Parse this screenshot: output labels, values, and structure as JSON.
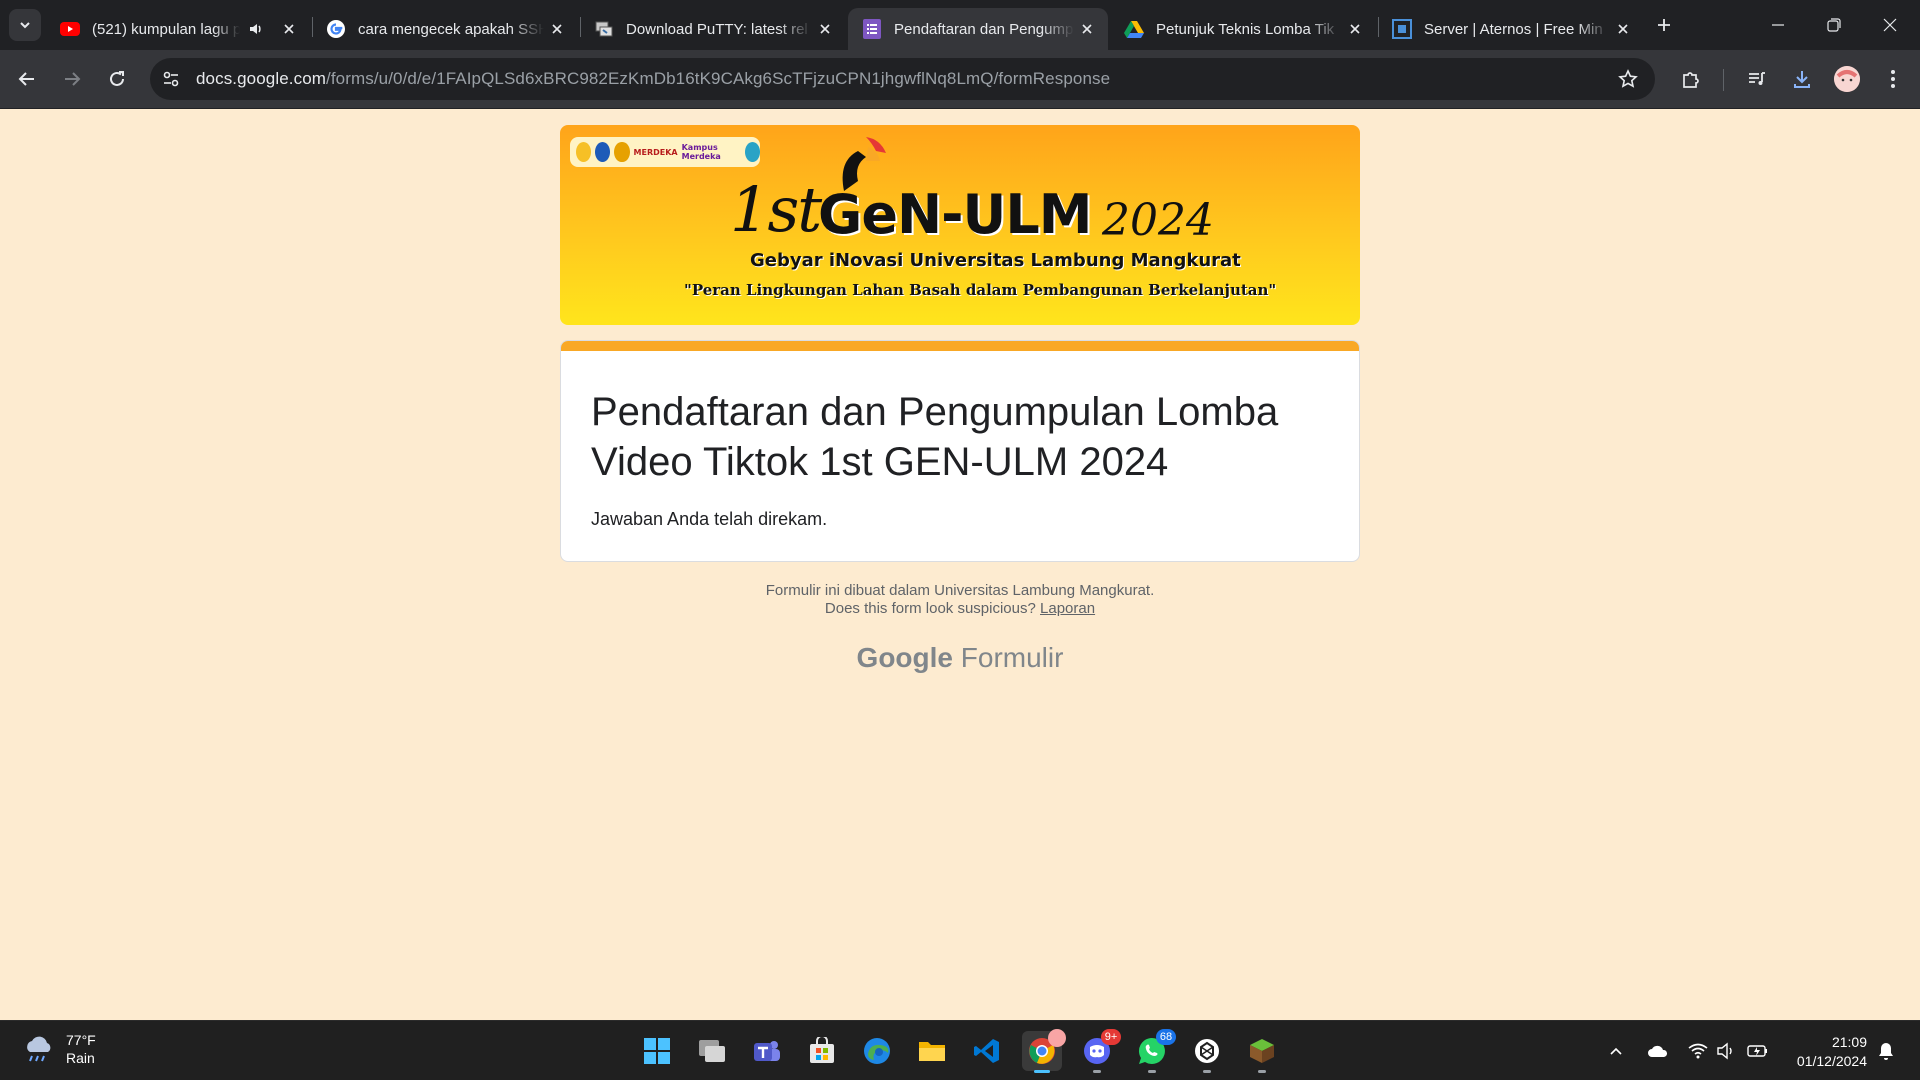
{
  "browser": {
    "tabs": [
      {
        "title": "(521) kumpulan lagu p",
        "favicon": "youtube-icon",
        "has_audio": true,
        "active": false
      },
      {
        "title": "cara mengecek apakah SSH",
        "favicon": "google-icon",
        "has_audio": false,
        "active": false
      },
      {
        "title": "Download PuTTY: latest rel",
        "favicon": "putty-icon",
        "has_audio": false,
        "active": false
      },
      {
        "title": "Pendaftaran dan Pengump",
        "favicon": "google-forms-icon",
        "has_audio": false,
        "active": true
      },
      {
        "title": "Petunjuk Teknis Lomba Tik",
        "favicon": "google-drive-icon",
        "has_audio": false,
        "active": false
      },
      {
        "title": "Server | Aternos | Free Min",
        "favicon": "aternos-icon",
        "has_audio": false,
        "active": false
      }
    ],
    "url_host": "docs.google.com",
    "url_path": "/forms/u/0/d/e/1FAIpQLSd6xBRC982EzKmDb16tK9CAkg6ScTFjzuCPN1jhgwflNq8LmQ/formResponse",
    "accent": "#f9a825"
  },
  "banner": {
    "logo_text_1": "MERDEKA",
    "logo_text_2": "Kampus Merdeka",
    "title_prefix": "1st",
    "title_main": "GeN-ULM",
    "title_year": "2024",
    "subtitle": "Gebyar iNovasi Universitas Lambung Mangkurat",
    "tagline": "\"Peran Lingkungan Lahan Basah dalam Pembangunan Berkelanjutan\""
  },
  "form": {
    "title": "Pendaftaran dan Pengumpulan Lomba Video Tiktok 1st GEN-ULM 2024",
    "confirmation": "Jawaban Anda telah direkam.",
    "footer_line1": "Formulir ini dibuat dalam Universitas Lambung Mangkurat.",
    "footer_line2": "Does this form look suspicious?",
    "report_link": "Laporan",
    "brand_google": "Google",
    "brand_product": "Formulir"
  },
  "taskbar": {
    "weather_temp": "77°F",
    "weather_desc": "Rain",
    "discord_badge": "9+",
    "whatsapp_badge": "68",
    "time": "21:09",
    "date": "01/12/2024"
  }
}
